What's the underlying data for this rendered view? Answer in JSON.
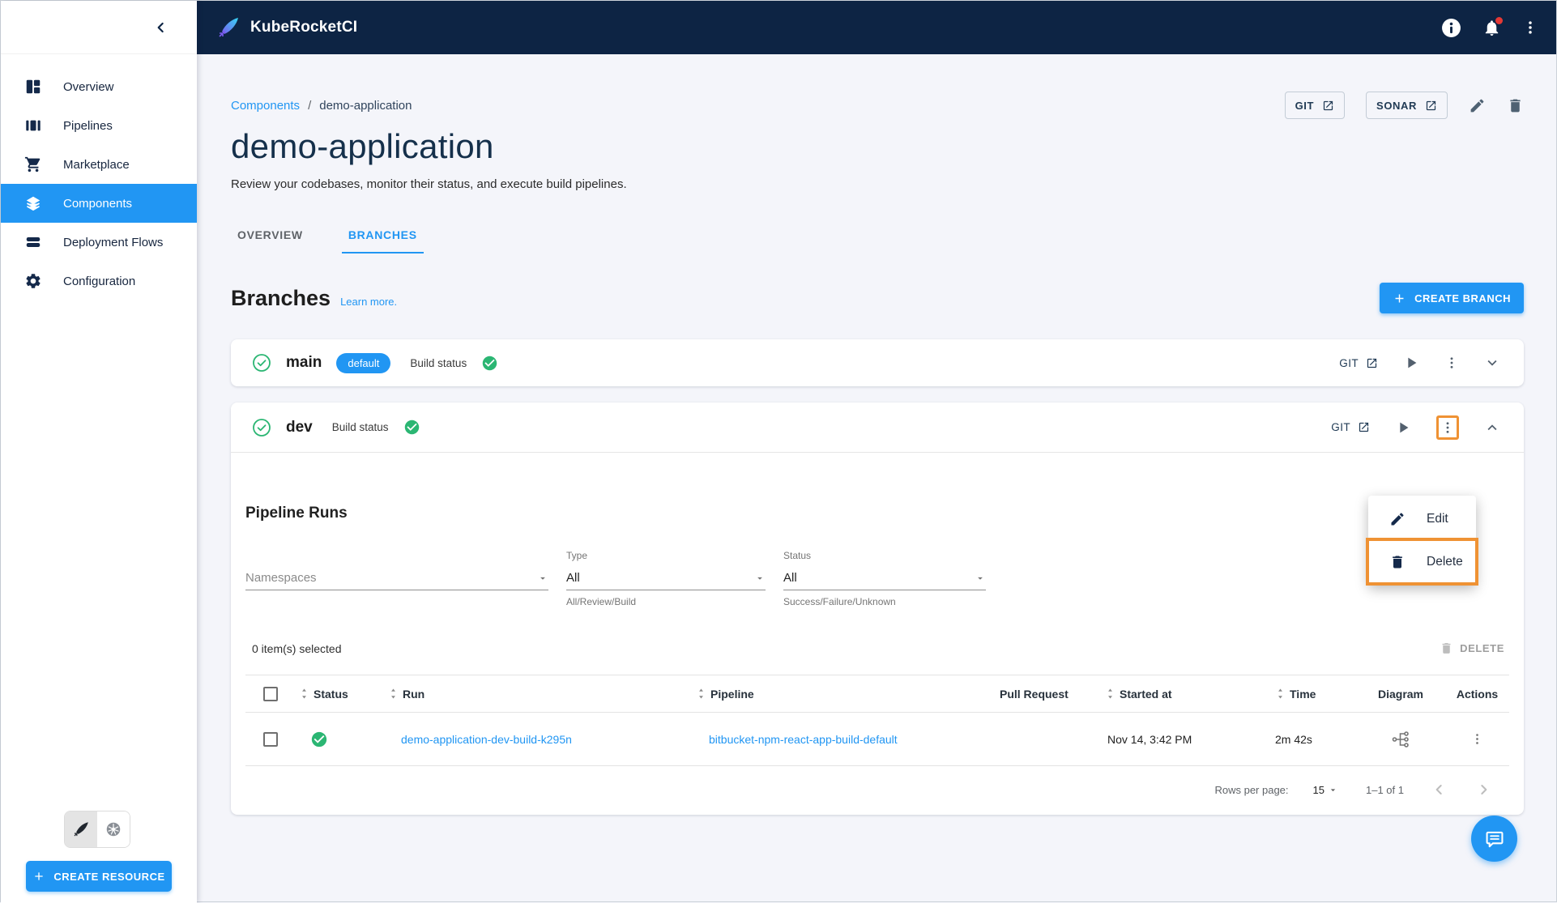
{
  "app": {
    "title": "KubeRocketCI"
  },
  "colors": {
    "topbar_bg": "#0d2444",
    "primary": "#2196f3",
    "success": "#2bb673",
    "highlight": "#ef9234"
  },
  "sidebar": {
    "items": [
      {
        "label": "Overview"
      },
      {
        "label": "Pipelines"
      },
      {
        "label": "Marketplace"
      },
      {
        "label": "Components",
        "active": true
      },
      {
        "label": "Deployment Flows"
      },
      {
        "label": "Configuration"
      }
    ],
    "create_resource_label": "CREATE RESOURCE"
  },
  "breadcrumb": {
    "parent": "Components",
    "separator": "/",
    "current": "demo-application"
  },
  "header_actions": {
    "git_label": "GIT",
    "sonar_label": "SONAR"
  },
  "page": {
    "title": "demo-application",
    "subtitle": "Review your codebases, monitor their status, and execute build pipelines."
  },
  "tabs": [
    {
      "label": "OVERVIEW"
    },
    {
      "label": "BRANCHES",
      "active": true
    }
  ],
  "branches_section": {
    "heading": "Branches",
    "learn_more": "Learn more.",
    "create_branch_label": "CREATE BRANCH"
  },
  "branches": [
    {
      "name": "main",
      "default_chip": "default",
      "build_status_label": "Build status",
      "git_label": "GIT"
    },
    {
      "name": "dev",
      "build_status_label": "Build status",
      "git_label": "GIT"
    }
  ],
  "context_menu": {
    "edit_label": "Edit",
    "delete_label": "Delete"
  },
  "pipeline_runs": {
    "heading": "Pipeline Runs",
    "filters": {
      "namespaces": {
        "placeholder": "Namespaces"
      },
      "type": {
        "label": "Type",
        "value": "All",
        "helper": "All/Review/Build"
      },
      "status": {
        "label": "Status",
        "value": "All",
        "helper": "Success/Failure/Unknown"
      }
    },
    "selection_text": "0 item(s) selected",
    "delete_label": "DELETE",
    "table": {
      "columns": [
        "Status",
        "Run",
        "Pipeline",
        "Pull Request",
        "Started at",
        "Time",
        "Diagram",
        "Actions"
      ],
      "rows": [
        {
          "run": "demo-application-dev-build-k295n",
          "pipeline": "bitbucket-npm-react-app-build-default",
          "pull_request": "",
          "started_at": "Nov 14, 3:42 PM",
          "time": "2m 42s"
        }
      ]
    },
    "pagination": {
      "rows_per_page_label": "Rows per page:",
      "rows_per_page_value": "15",
      "range": "1–1 of 1"
    }
  }
}
